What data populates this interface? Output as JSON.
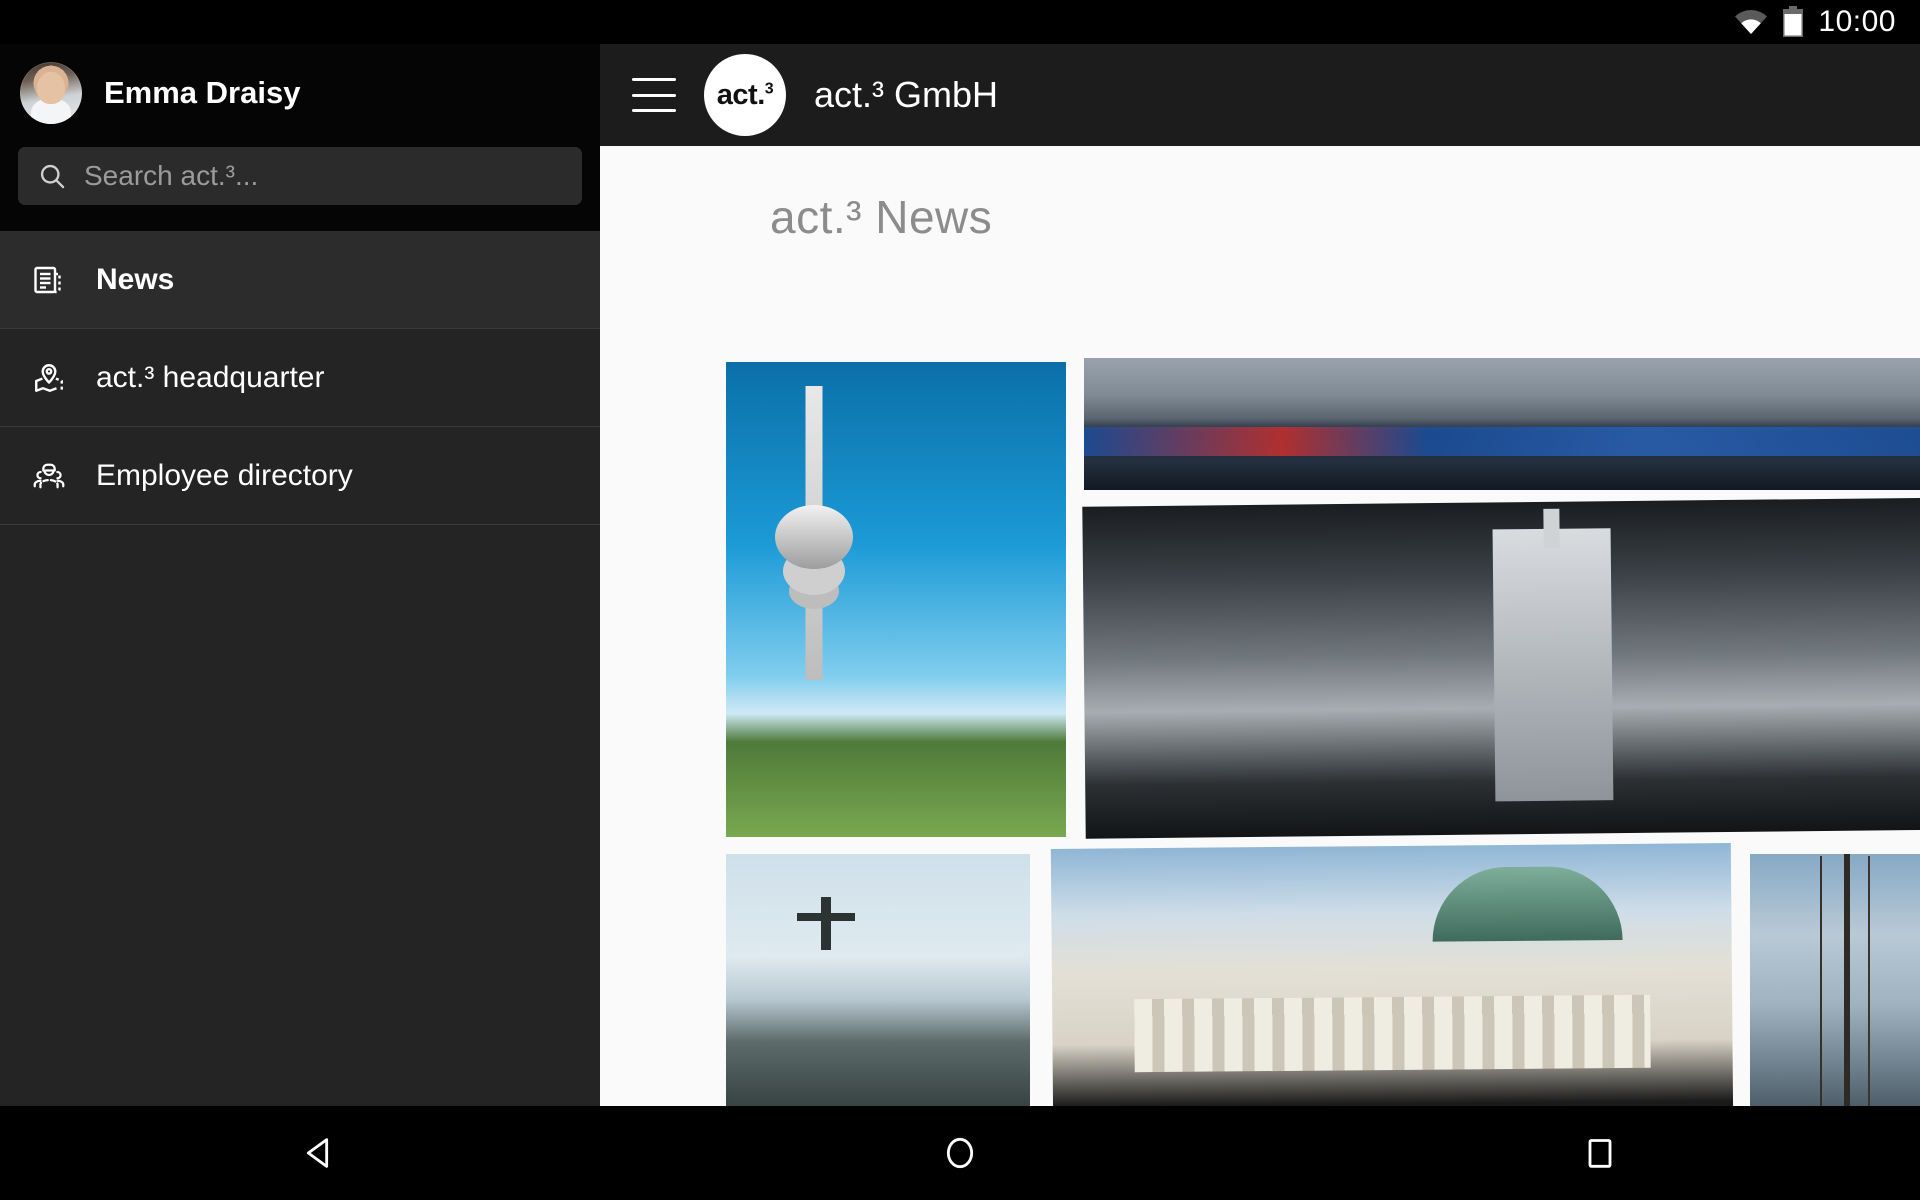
{
  "status_bar": {
    "time": "10:00",
    "icons": [
      "wifi-icon",
      "battery-icon"
    ]
  },
  "sidebar": {
    "profile": {
      "name": "Emma Draisy",
      "avatar": "user-avatar"
    },
    "search": {
      "placeholder": "Search act.³...",
      "icon": "search-icon",
      "value": ""
    },
    "items": [
      {
        "label": "News",
        "icon": "newspaper-icon",
        "selected": true
      },
      {
        "label": "act.³ headquarter",
        "icon": "map-pin-icon",
        "selected": false
      },
      {
        "label": "Employee directory",
        "icon": "people-group-icon",
        "selected": false
      }
    ]
  },
  "appbar": {
    "menu_icon": "hamburger-menu-icon",
    "logo_text": "act.",
    "logo_sup": "3",
    "title": "act.³ GmbH"
  },
  "main": {
    "page_title": "act.³ News",
    "gallery": [
      {
        "name": "munich-olympic-tower"
      },
      {
        "name": "olympic-stadium-panorama"
      },
      {
        "name": "warsaw-palace-of-culture"
      },
      {
        "name": "night-city-lights"
      },
      {
        "name": "christ-the-redeemer"
      },
      {
        "name": "reichstag-berlin"
      },
      {
        "name": "office-building-tree"
      }
    ]
  },
  "navigation_bar": {
    "back": "back-triangle-icon",
    "home": "home-circle-icon",
    "recents": "recents-square-icon"
  },
  "colors": {
    "status_bar_bg": "#000000",
    "drawer_top_bg": "#050505",
    "drawer_bg": "#242424",
    "drawer_selected_bg": "#2c2c2c",
    "search_field_bg": "#2b2b2b",
    "appbar_bg": "#1c1c1c",
    "content_bg": "#fafafa",
    "title_text": "#8c8c8c",
    "primary_text": "#ffffff"
  }
}
